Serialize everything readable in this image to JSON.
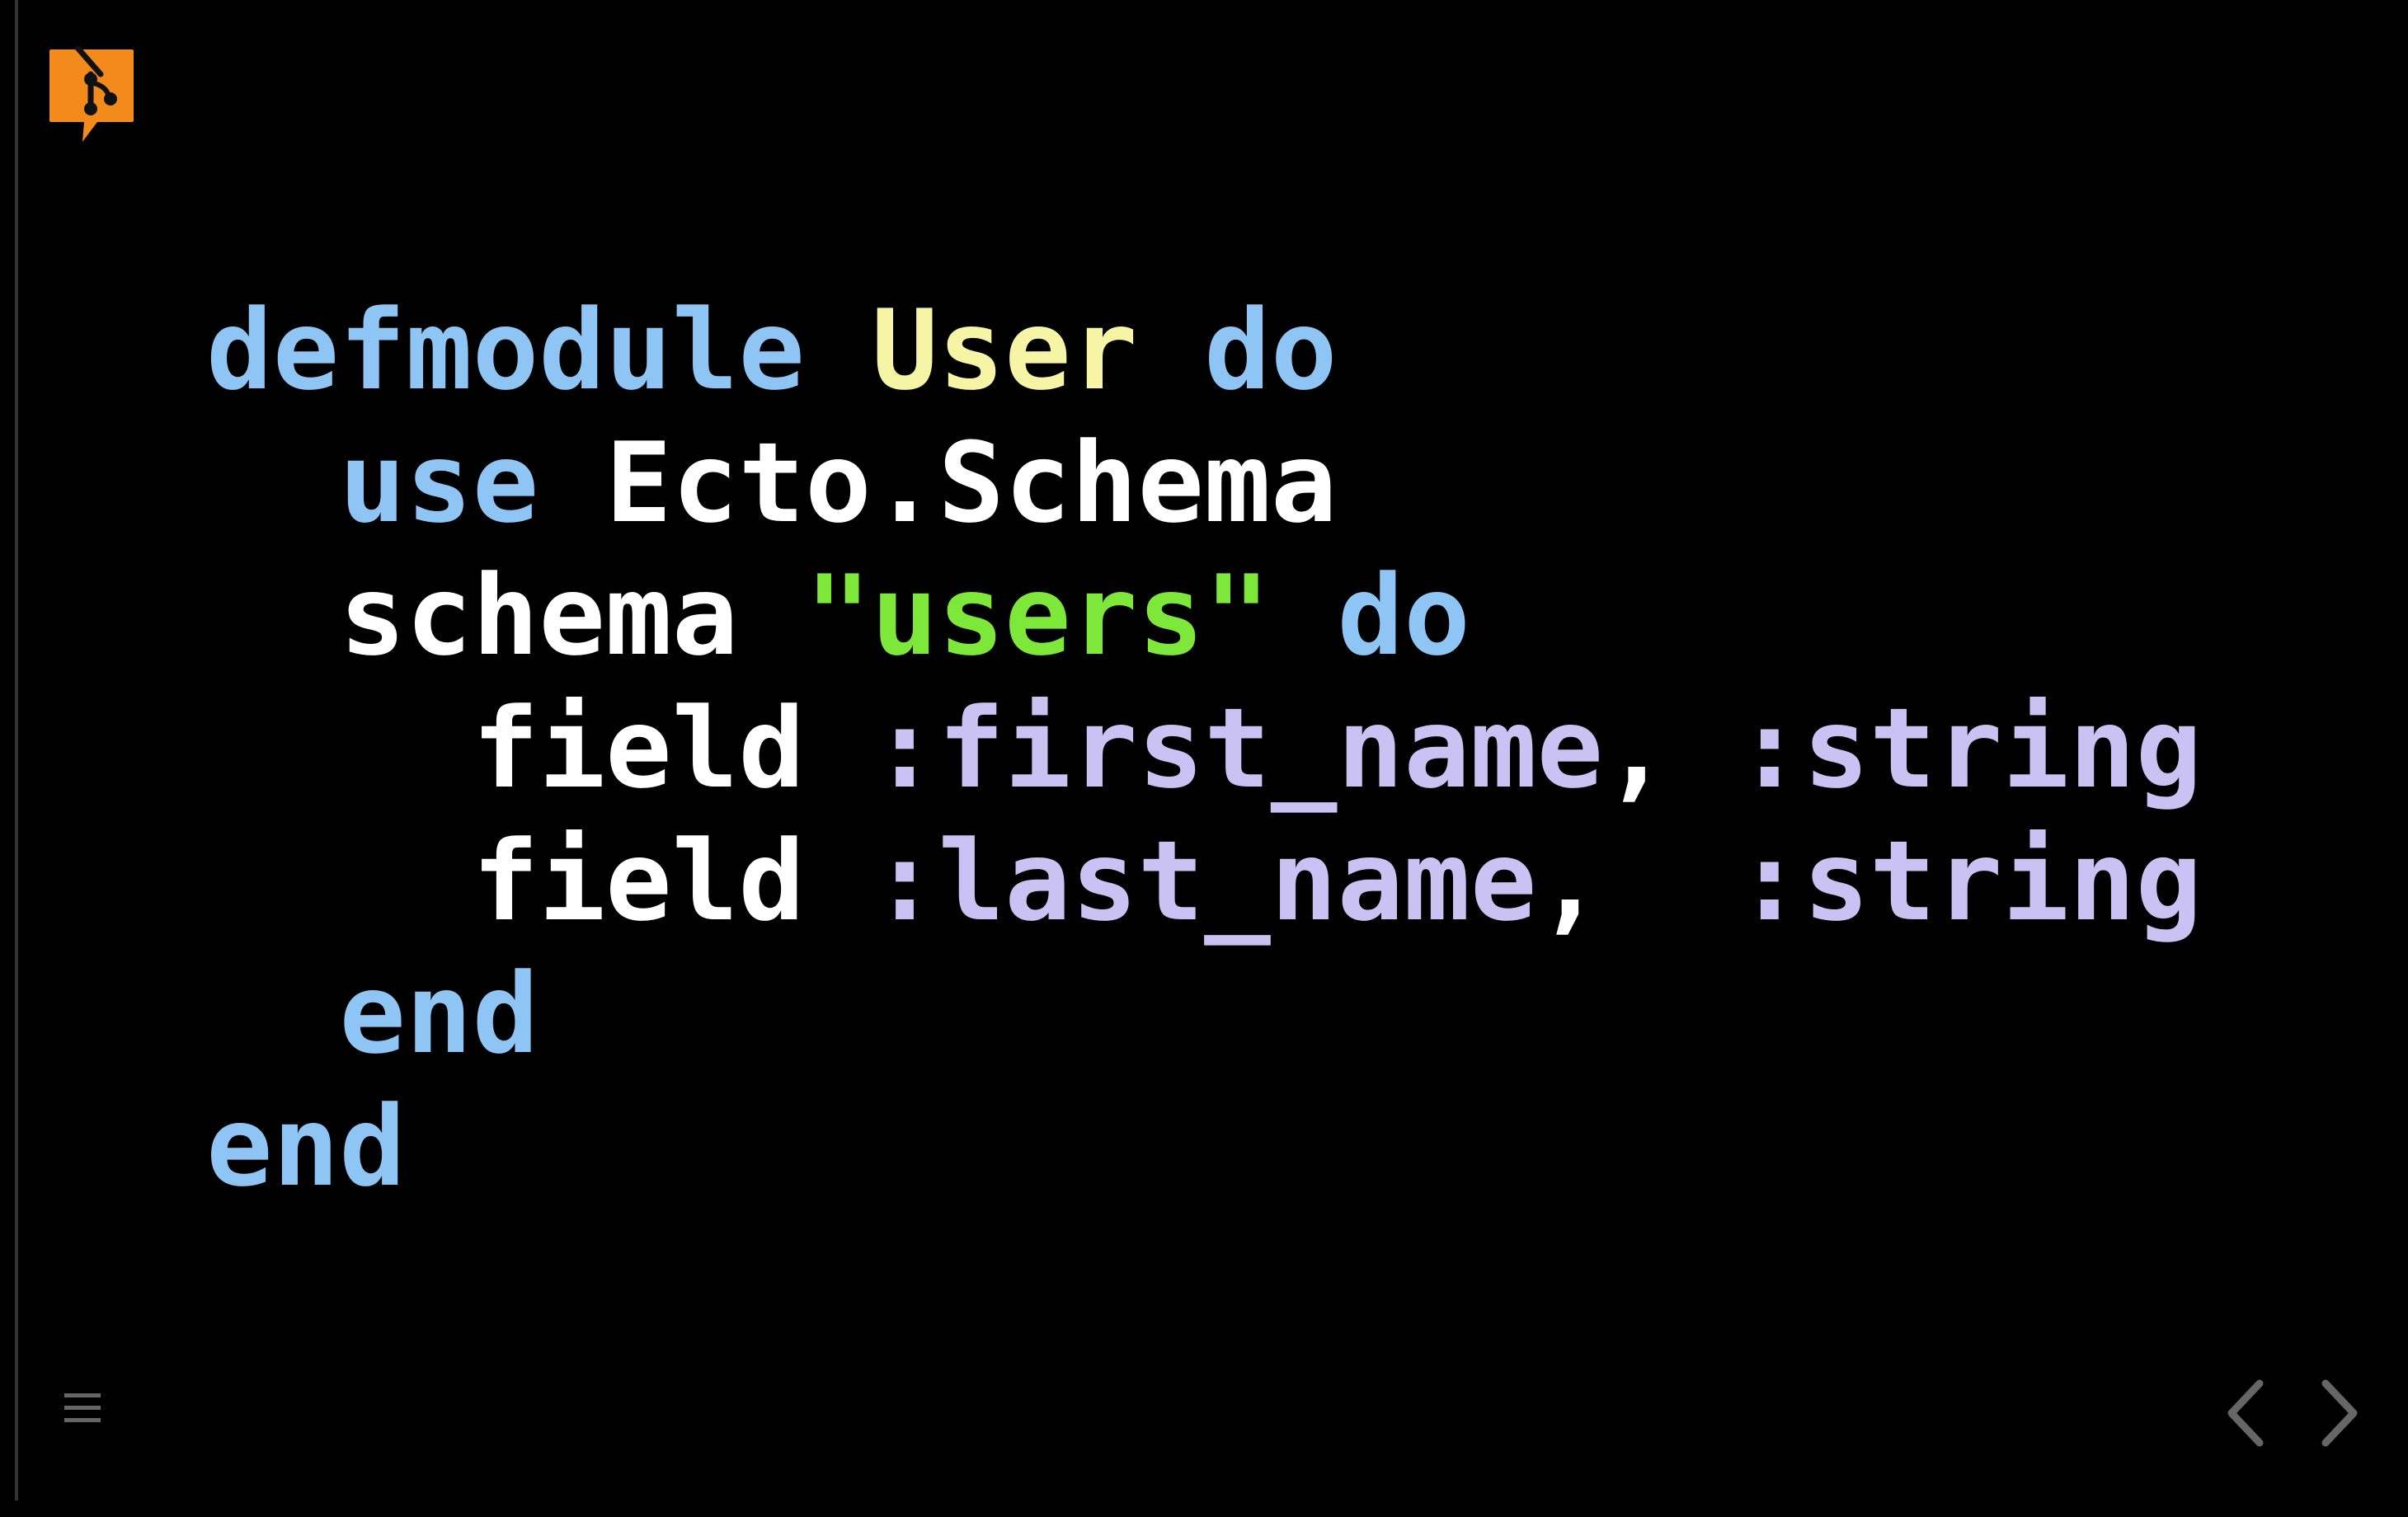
{
  "colors": {
    "background": "#000000",
    "keyword": "#8ec5f4",
    "module": "#f5f5a5",
    "string": "#7ee83a",
    "atom": "#c9c2f2",
    "plain": "#ffffff",
    "logo": "#f28a1c",
    "controls": "#666666"
  },
  "icons": {
    "logo": "git-branch-speech-bubble-icon",
    "menu": "hamburger-menu-icon",
    "prev": "chevron-left-icon",
    "next": "chevron-right-icon"
  },
  "code": {
    "lines": [
      {
        "tokens": [
          {
            "text": "defmodule",
            "kind": "kw"
          },
          {
            "text": " ",
            "kind": "plain"
          },
          {
            "text": "User",
            "kind": "mod"
          },
          {
            "text": " ",
            "kind": "plain"
          },
          {
            "text": "do",
            "kind": "kw"
          }
        ]
      },
      {
        "tokens": [
          {
            "text": "  ",
            "kind": "plain"
          },
          {
            "text": "use",
            "kind": "kw"
          },
          {
            "text": " Ecto.Schema",
            "kind": "plain"
          }
        ]
      },
      {
        "tokens": [
          {
            "text": "  schema ",
            "kind": "plain"
          },
          {
            "text": "\"users\"",
            "kind": "str"
          },
          {
            "text": " ",
            "kind": "plain"
          },
          {
            "text": "do",
            "kind": "kw"
          }
        ]
      },
      {
        "tokens": [
          {
            "text": "    field ",
            "kind": "plain"
          },
          {
            "text": ":first_name",
            "kind": "atom"
          },
          {
            "text": ", ",
            "kind": "plain"
          },
          {
            "text": ":string",
            "kind": "atom"
          }
        ]
      },
      {
        "tokens": [
          {
            "text": "    field ",
            "kind": "plain"
          },
          {
            "text": ":last_name",
            "kind": "atom"
          },
          {
            "text": ",  ",
            "kind": "plain"
          },
          {
            "text": ":string",
            "kind": "atom"
          }
        ]
      },
      {
        "tokens": [
          {
            "text": "  ",
            "kind": "plain"
          },
          {
            "text": "end",
            "kind": "kw"
          }
        ]
      },
      {
        "tokens": [
          {
            "text": "end",
            "kind": "kw"
          }
        ]
      }
    ]
  }
}
